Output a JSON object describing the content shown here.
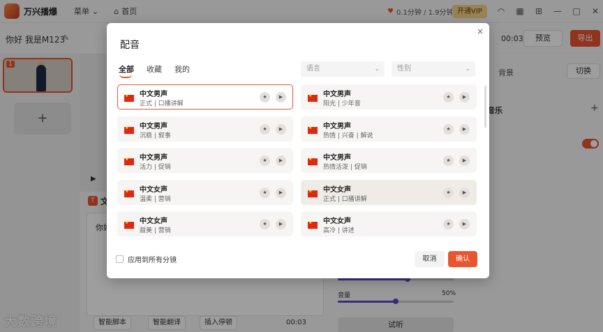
{
  "app": {
    "name": "万兴播爆",
    "menu_label": "菜单",
    "home_label": "首页",
    "minutes": "0.1分钟 / 1.9分钟",
    "vip_label": "开通VIP"
  },
  "project": {
    "title": "你好 我是M123",
    "time": "00:03",
    "preview_label": "预览",
    "export_label": "导出"
  },
  "scenes": {
    "first_index": "1",
    "add_label": "+"
  },
  "script": {
    "title": "文",
    "text": "你好",
    "smart_script": "智能脚本",
    "smart_translate": "智能翻译",
    "insert_pause": "插入停顿",
    "time": "00:03"
  },
  "right_panel": {
    "background_label": "背景",
    "switch_label": "切换",
    "music_label": "音乐",
    "add_label": "+",
    "volume_label": "音量",
    "volume_value": "50%",
    "volume_fraction": 0.5,
    "tryout_label": "试听"
  },
  "watermark": "大数跨境",
  "modal": {
    "title": "配音",
    "close_icon": "×",
    "tabs": [
      {
        "label": "全部",
        "active": true
      },
      {
        "label": "收藏",
        "active": false
      },
      {
        "label": "我的",
        "active": false
      }
    ],
    "language_placeholder": "语言",
    "gender_placeholder": "性别",
    "voices": [
      {
        "name": "中文男声",
        "desc": "正式 | 口播讲解",
        "selected": true
      },
      {
        "name": "中文男声",
        "desc": "阳光 | 少年音",
        "selected": false
      },
      {
        "name": "中文男声",
        "desc": "沉稳 | 叙事",
        "selected": false
      },
      {
        "name": "中文男声",
        "desc": "热情 | 兴奋 | 解说",
        "selected": false
      },
      {
        "name": "中文男声",
        "desc": "活力 | 促销",
        "selected": false
      },
      {
        "name": "中文男声",
        "desc": "热情活泼 | 促销",
        "selected": false
      },
      {
        "name": "中文女声",
        "desc": "温柔 | 营销",
        "selected": false
      },
      {
        "name": "中文女声",
        "desc": "正式 | 口播讲解",
        "selected": false,
        "hover": true
      },
      {
        "name": "中文女声",
        "desc": "甜美 | 营销",
        "selected": false
      },
      {
        "name": "中文女声",
        "desc": "高冷 | 讲述",
        "selected": false
      }
    ],
    "apply_all_label": "应用到所有分镜",
    "cancel_label": "取消",
    "confirm_label": "确认"
  }
}
